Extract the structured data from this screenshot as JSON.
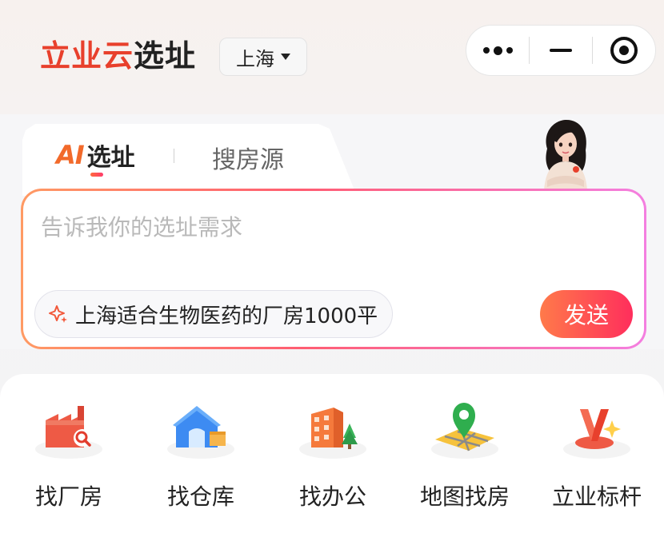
{
  "header": {
    "brand": "立业云",
    "brand_suffix": "选址",
    "city": "上海"
  },
  "capsule": {
    "more_icon": "more-dots-icon",
    "minimize_icon": "minimize-icon",
    "close_icon": "target-close-icon"
  },
  "tabs": [
    {
      "mark": "AI",
      "label": "选址",
      "active": true
    },
    {
      "label": "搜房源",
      "active": false
    }
  ],
  "search": {
    "placeholder": "告诉我你的选址需求",
    "suggestion": "上海适合生物医药的厂房1000平",
    "send_label": "发送"
  },
  "entries": [
    {
      "label": "找厂房",
      "icon": "factory-search-icon"
    },
    {
      "label": "找仓库",
      "icon": "warehouse-icon"
    },
    {
      "label": "找办公",
      "icon": "office-building-icon"
    },
    {
      "label": "地图找房",
      "icon": "map-pin-icon"
    },
    {
      "label": "立业标杆",
      "icon": "benchmark-trophy-icon"
    }
  ],
  "colors": {
    "brand_red": "#e8402c",
    "send_gradient_start": "#ff7a4a",
    "send_gradient_end": "#ff2e5c",
    "border_gradient": [
      "#ff9a64",
      "#ff5d72",
      "#f47fe0"
    ]
  }
}
